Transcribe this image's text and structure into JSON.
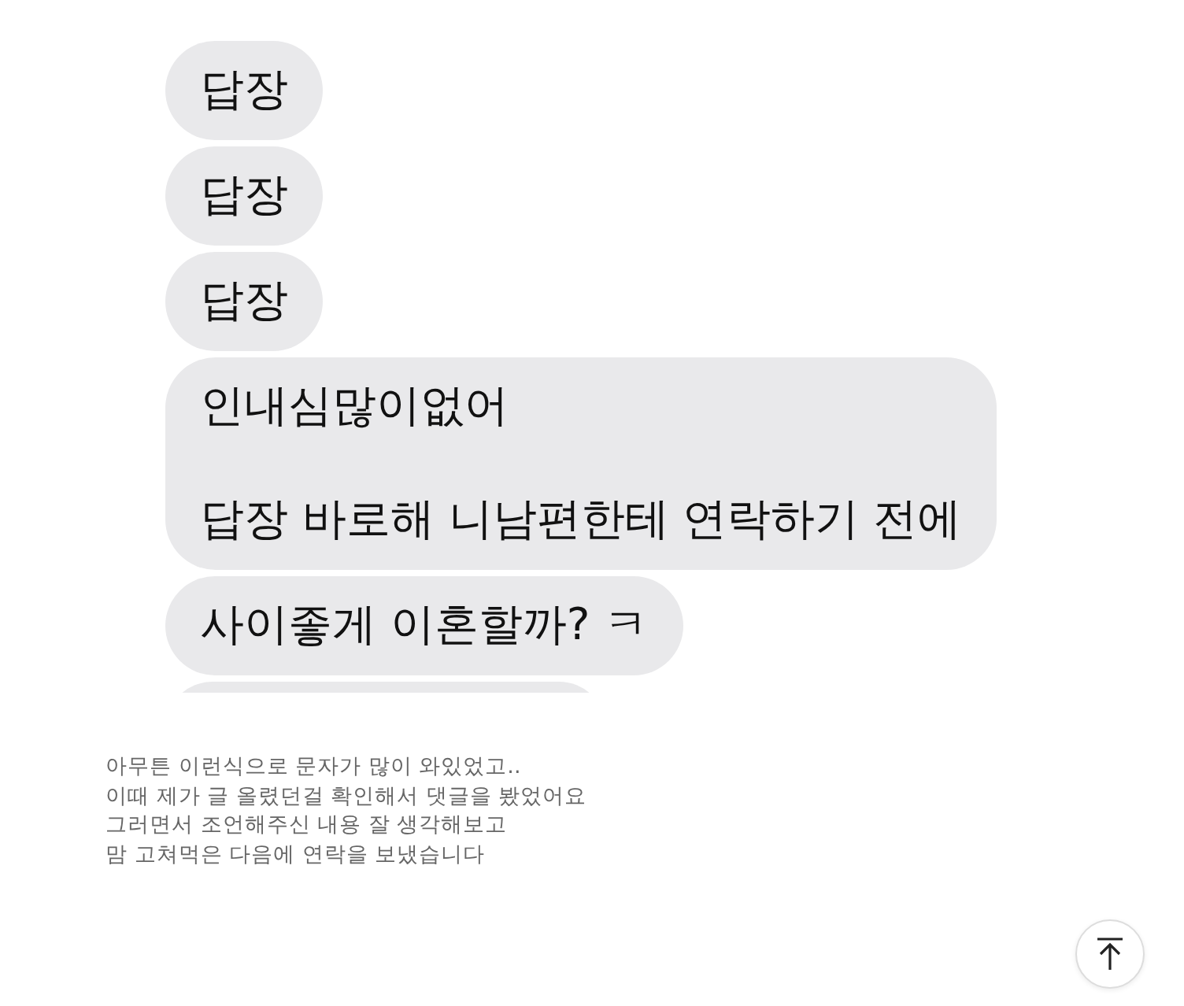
{
  "messages": [
    {
      "lines": [
        "답장"
      ]
    },
    {
      "lines": [
        "답장"
      ]
    },
    {
      "lines": [
        "답장"
      ]
    },
    {
      "lines": [
        "인내심많이없어",
        "답장 바로해 니남편한테 연락하기 전에"
      ]
    },
    {
      "lines": [
        "사이좋게 이혼할까? ㅋ"
      ]
    }
  ],
  "paragraph": [
    "아무튼 이런식으로 문자가 많이 와있었고..",
    "이때 제가 글 올렸던걸 확인해서 댓글을 봤었어요",
    "그러면서 조언해주신 내용 잘 생각해보고",
    "맘 고쳐먹은 다음에 연락을 보냈습니다"
  ]
}
